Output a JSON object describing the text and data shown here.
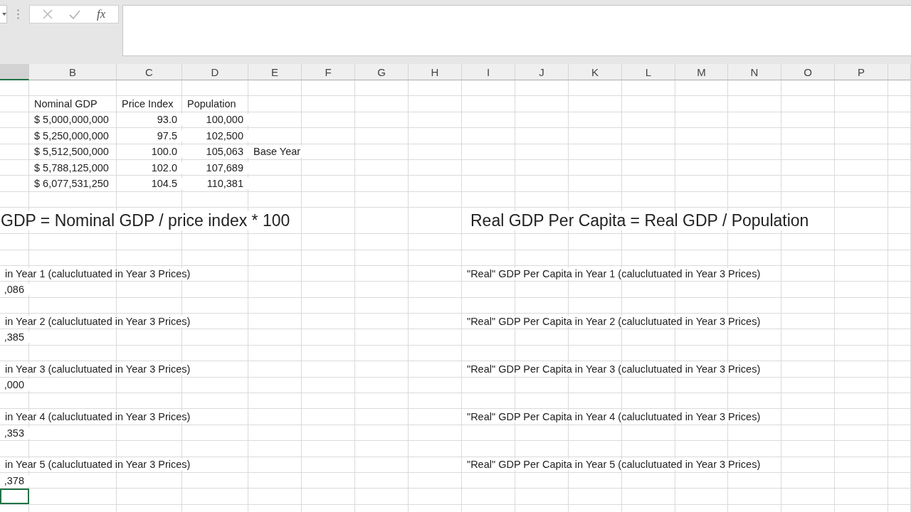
{
  "formula_bar": {
    "function_label": "fx"
  },
  "columns": [
    {
      "selected": true
    },
    {
      "label": "B",
      "selected": false
    },
    {
      "label": "C",
      "selected": false
    },
    {
      "label": "D",
      "selected": false
    },
    {
      "label": "E",
      "selected": false
    },
    {
      "label": "F",
      "selected": false
    },
    {
      "label": "G",
      "selected": false
    },
    {
      "label": "H",
      "selected": false
    },
    {
      "label": "I",
      "selected": false
    },
    {
      "label": "J",
      "selected": false
    },
    {
      "label": "K",
      "selected": false
    },
    {
      "label": "L",
      "selected": false
    },
    {
      "label": "M",
      "selected": false
    },
    {
      "label": "N",
      "selected": false
    },
    {
      "label": "O",
      "selected": false
    },
    {
      "label": "P",
      "selected": false
    },
    {
      "selected": false
    }
  ],
  "rows": [
    {
      "kind": "blank"
    },
    {
      "kind": "text",
      "cells": {
        "B": {
          "text": "Nominal GDP",
          "kind": "label"
        },
        "C": {
          "text": "Price Index",
          "kind": "label"
        },
        "D": {
          "text": "Population",
          "kind": "label"
        }
      }
    },
    {
      "kind": "text",
      "cells": {
        "B": {
          "text": "$ 5,000,000,000",
          "kind": "label"
        },
        "C": {
          "text": "93.0",
          "kind": "number"
        },
        "D": {
          "text": "100,000",
          "kind": "number"
        }
      }
    },
    {
      "kind": "text",
      "cells": {
        "B": {
          "text": "$ 5,250,000,000",
          "kind": "label"
        },
        "C": {
          "text": "97.5",
          "kind": "number"
        },
        "D": {
          "text": "102,500",
          "kind": "number"
        }
      }
    },
    {
      "kind": "text",
      "cells": {
        "B": {
          "text": "$ 5,512,500,000",
          "kind": "label"
        },
        "C": {
          "text": "100.0",
          "kind": "number"
        },
        "D": {
          "text": "105,063",
          "kind": "number"
        },
        "E": {
          "text": "Base Year",
          "kind": "label"
        }
      }
    },
    {
      "kind": "text",
      "cells": {
        "B": {
          "text": "$ 5,788,125,000",
          "kind": "label"
        },
        "C": {
          "text": "102.0",
          "kind": "number"
        },
        "D": {
          "text": "107,689",
          "kind": "number"
        }
      }
    },
    {
      "kind": "text",
      "cells": {
        "B": {
          "text": "$ 6,077,531,250",
          "kind": "label"
        },
        "C": {
          "text": "104.5",
          "kind": "number"
        },
        "D": {
          "text": "110,381",
          "kind": "number"
        }
      }
    },
    {
      "kind": "blank"
    },
    {
      "kind": "heading",
      "cells": {
        "A": {
          "text": "GDP = Nominal GDP / price index * 100",
          "kind": "label"
        },
        "I": {
          "text": "Real GDP Per Capita = Real GDP / Population",
          "kind": "label"
        }
      }
    },
    {
      "kind": "blank"
    },
    {
      "kind": "blank"
    },
    {
      "kind": "text",
      "cells": {
        "A": {
          "text": "in Year 1 (caluclutuated in Year 3 Prices)",
          "kind": "label"
        },
        "I": {
          "text": "\"Real\" GDP Per Capita in Year 1 (caluclutuated in Year 3 Prices)",
          "kind": "label"
        }
      }
    },
    {
      "kind": "text",
      "cells": {
        "A": {
          "text": ",086",
          "kind": "number"
        }
      }
    },
    {
      "kind": "blank"
    },
    {
      "kind": "text",
      "cells": {
        "A": {
          "text": "in Year 2 (caluclutuated in Year 3 Prices)",
          "kind": "label"
        },
        "I": {
          "text": "\"Real\" GDP Per Capita in Year 2 (caluclutuated in Year 3 Prices)",
          "kind": "label"
        }
      }
    },
    {
      "kind": "text",
      "cells": {
        "A": {
          "text": ",385",
          "kind": "number"
        }
      }
    },
    {
      "kind": "blank"
    },
    {
      "kind": "text",
      "cells": {
        "A": {
          "text": "in Year 3 (caluclutuated in Year 3 Prices)",
          "kind": "label"
        },
        "I": {
          "text": "\"Real\" GDP Per Capita in Year 3 (caluclutuated in Year 3 Prices)",
          "kind": "label"
        }
      }
    },
    {
      "kind": "text",
      "cells": {
        "A": {
          "text": ",000",
          "kind": "number"
        }
      }
    },
    {
      "kind": "blank"
    },
    {
      "kind": "text",
      "cells": {
        "A": {
          "text": "in Year 4 (caluclutuated in Year 3 Prices)",
          "kind": "label"
        },
        "I": {
          "text": "\"Real\" GDP Per Capita in Year 4 (caluclutuated in Year 3 Prices)",
          "kind": "label"
        }
      }
    },
    {
      "kind": "text",
      "cells": {
        "A": {
          "text": ",353",
          "kind": "number"
        }
      }
    },
    {
      "kind": "blank"
    },
    {
      "kind": "text",
      "cells": {
        "A": {
          "text": "in Year 5 (caluclutuated in Year 3 Prices)",
          "kind": "label"
        },
        "I": {
          "text": "\"Real\" GDP Per Capita in Year 5 (caluclutuated in Year 3 Prices)",
          "kind": "label"
        }
      }
    },
    {
      "kind": "text",
      "cells": {
        "A": {
          "text": ",378",
          "kind": "number"
        }
      }
    },
    {
      "kind": "text",
      "cells": {
        "A": {
          "active": true
        }
      }
    },
    {
      "kind": "blank"
    }
  ]
}
